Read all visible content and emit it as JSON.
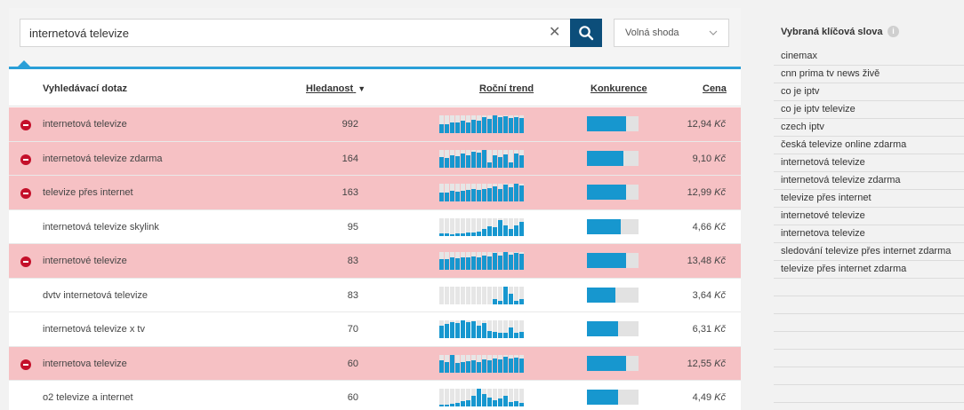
{
  "search": {
    "value": "internetová televize",
    "clear_icon": "close-icon",
    "button_icon": "search-icon",
    "match_type": "Volná shoda"
  },
  "colors": {
    "accent": "#2a9fd8",
    "bar": "#1797cf",
    "bar_low": "#cfdae0",
    "negative_row": "#f6c1c4",
    "remove": "#c4102a",
    "search_button": "#0c4e7a"
  },
  "table": {
    "headers": {
      "query": "Vyhledávací dotaz",
      "search_volume": "Hledanost",
      "sort_indicator": "▼",
      "trend": "Roční trend",
      "competition": "Konkurence",
      "price": "Cena"
    },
    "rows": [
      {
        "query": "internetová televize",
        "volume": "992",
        "price": "12,94",
        "currency": "Kč",
        "negative": true,
        "competition": 0.75,
        "trend": [
          0.5,
          0.5,
          0.6,
          0.6,
          0.7,
          0.6,
          0.75,
          0.7,
          0.9,
          0.8,
          1.0,
          0.9,
          0.95,
          0.85,
          0.9,
          0.85
        ]
      },
      {
        "query": "internetová televize zdarma",
        "volume": "164",
        "price": "9,10",
        "currency": "Kč",
        "negative": true,
        "competition": 0.7,
        "trend": [
          0.6,
          0.55,
          0.7,
          0.65,
          0.8,
          0.7,
          0.9,
          0.85,
          1.0,
          0.3,
          0.7,
          0.6,
          0.75,
          0.3,
          0.8,
          0.7
        ]
      },
      {
        "query": "televize přes internet",
        "volume": "163",
        "price": "12,99",
        "currency": "Kč",
        "negative": true,
        "competition": 0.75,
        "trend": [
          0.5,
          0.5,
          0.6,
          0.55,
          0.6,
          0.65,
          0.7,
          0.65,
          0.7,
          0.75,
          0.85,
          0.7,
          0.95,
          0.8,
          1.0,
          0.9
        ]
      },
      {
        "query": "internetová televize skylink",
        "volume": "95",
        "price": "4,66",
        "currency": "Kč",
        "negative": false,
        "competition": 0.65,
        "trend": [
          0.15,
          0.15,
          0.1,
          0.15,
          0.15,
          0.2,
          0.2,
          0.25,
          0.4,
          0.55,
          0.5,
          0.9,
          0.6,
          0.4,
          0.6,
          0.8
        ]
      },
      {
        "query": "internetové televize",
        "volume": "83",
        "price": "13,48",
        "currency": "Kč",
        "negative": true,
        "competition": 0.75,
        "trend": [
          0.6,
          0.6,
          0.7,
          0.65,
          0.7,
          0.7,
          0.75,
          0.7,
          0.8,
          0.75,
          0.95,
          0.8,
          1.0,
          0.85,
          0.95,
          0.9
        ]
      },
      {
        "query": "dvtv internetová televize",
        "volume": "83",
        "price": "3,64",
        "currency": "Kč",
        "negative": false,
        "competition": 0.55,
        "trend": [
          0.0,
          0.0,
          0.0,
          0.0,
          0.0,
          0.0,
          0.0,
          0.0,
          0.0,
          0.0,
          0.3,
          0.2,
          1.0,
          0.6,
          0.2,
          0.3
        ]
      },
      {
        "query": "internetová televize x tv",
        "volume": "70",
        "price": "6,31",
        "currency": "Kč",
        "negative": false,
        "competition": 0.6,
        "trend": [
          0.7,
          0.8,
          0.9,
          0.85,
          1.0,
          0.9,
          0.95,
          0.7,
          0.85,
          0.4,
          0.35,
          0.3,
          0.3,
          0.6,
          0.3,
          0.35
        ]
      },
      {
        "query": "internetova televize",
        "volume": "60",
        "price": "12,55",
        "currency": "Kč",
        "negative": true,
        "competition": 0.75,
        "trend": [
          0.7,
          0.6,
          1.0,
          0.55,
          0.6,
          0.65,
          0.7,
          0.6,
          0.75,
          0.7,
          0.8,
          0.75,
          0.9,
          0.8,
          0.85,
          0.8
        ]
      },
      {
        "query": "o2 televize a internet",
        "volume": "60",
        "price": "4,49",
        "currency": "Kč",
        "negative": false,
        "competition": 0.6,
        "trend": [
          0.1,
          0.1,
          0.15,
          0.2,
          0.3,
          0.35,
          0.6,
          1.0,
          0.7,
          0.5,
          0.35,
          0.45,
          0.6,
          0.25,
          0.3,
          0.2
        ]
      }
    ]
  },
  "panel": {
    "title": "Vybraná klíčová slova",
    "info_icon": "info-icon",
    "keywords": [
      "cinemax",
      "cnn prima tv news živě",
      "co je iptv",
      "co je iptv televize",
      "czech iptv",
      "česká televize online zdarma",
      "internetová televize",
      "internetová televize zdarma",
      "televize přes internet",
      "internetové televize",
      "internetova televize",
      "sledování televize přes internet zdarma",
      "televize přes internet zdarma",
      "",
      "",
      "",
      "",
      "",
      "",
      ""
    ]
  }
}
